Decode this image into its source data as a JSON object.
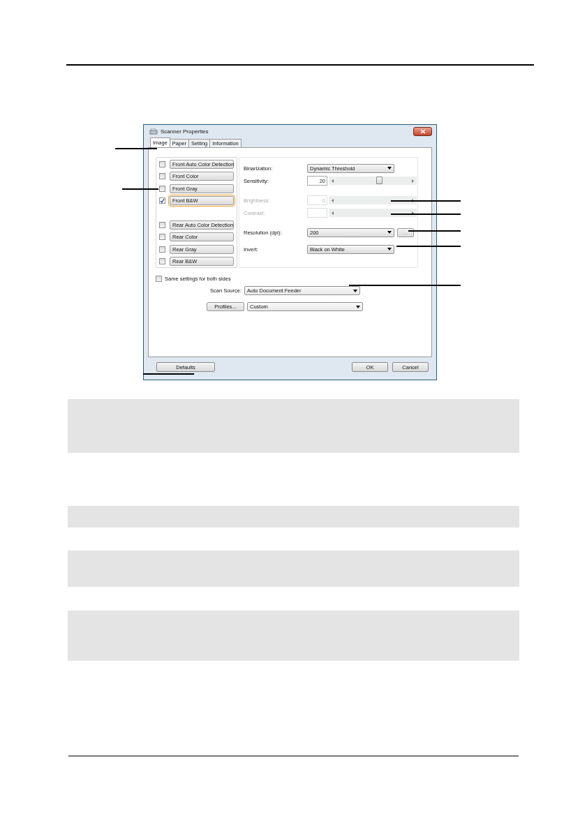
{
  "window": {
    "title": "Scanner Properties"
  },
  "tabs": [
    {
      "label": "Image",
      "selected": true
    },
    {
      "label": "Paper",
      "selected": false
    },
    {
      "label": "Setting",
      "selected": false
    },
    {
      "label": "Information",
      "selected": false
    }
  ],
  "front_modes": [
    {
      "label": "Front Auto Color Detection",
      "checked": false,
      "selected": false
    },
    {
      "label": "Front Color",
      "checked": false,
      "selected": false
    },
    {
      "label": "Front Gray",
      "checked": false,
      "selected": false
    },
    {
      "label": "Front B&W",
      "checked": true,
      "selected": true
    }
  ],
  "rear_modes": [
    {
      "label": "Rear Auto Color Detection",
      "checked": false,
      "selected": false
    },
    {
      "label": "Rear Color",
      "checked": false,
      "selected": false
    },
    {
      "label": "Rear Gray",
      "checked": false,
      "selected": false
    },
    {
      "label": "Rear B&W",
      "checked": false,
      "selected": false
    }
  ],
  "settings": [
    {
      "kind": "dropdown",
      "label": "Binarization:",
      "value": "Dynamic Threshold",
      "disabled": false
    },
    {
      "kind": "slider",
      "label": "Sensitivity:",
      "value": "20",
      "level": 0.57,
      "disabled": false
    },
    {
      "kind": "slider",
      "label": "Brightness:",
      "value": "0",
      "disabled": true
    },
    {
      "kind": "slider",
      "label": "Contrast:",
      "disabled": true
    },
    {
      "kind": "dropdown",
      "label": "Resolution (dpi):",
      "value": "200",
      "button": "...",
      "disabled": false
    },
    {
      "kind": "dropdown",
      "label": "Invert:",
      "value": "Black on White",
      "disabled": false
    }
  ],
  "same_settings": {
    "label": "Same settings for both sides",
    "checked": false
  },
  "scan_source": {
    "label": "Scan Source:",
    "value": "Auto Document Feeder"
  },
  "profiles": {
    "button": "Profiles...",
    "value": "Custom"
  },
  "buttons": [
    {
      "label": "Defaults",
      "kind": "left"
    },
    {
      "label": "OK",
      "kind": "right"
    },
    {
      "label": "Cancel",
      "kind": "right"
    }
  ]
}
